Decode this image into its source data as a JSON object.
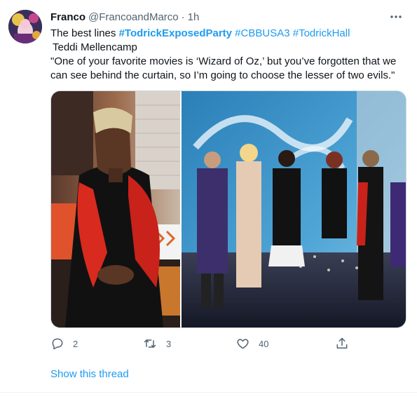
{
  "tweet": {
    "author_name": "Franco",
    "handle": "@FrancoandMarco",
    "separator": "·",
    "time": "1h",
    "text": {
      "intro": "The best lines ",
      "tag1": "#TodrickExposedParty",
      "tag2": " #CBBUSA3",
      "tag3": " #TodrickHall",
      "line2": "Teddi Mellencamp",
      "line3": "\"One of your favorite movies is ‘Wizard of Oz,’ but you’ve forgotten that we",
      "line4": "can see behind the curtain, so I’m going to choose the lesser of two evils.\""
    },
    "counts": {
      "replies": "2",
      "retweets": "3",
      "likes": "40"
    },
    "show_thread_label": "Show this thread"
  },
  "icons": {
    "more": "more-dots-icon",
    "reply": "reply-icon",
    "retweet": "retweet-icon",
    "like": "heart-icon",
    "share": "share-icon"
  },
  "colors": {
    "link": "#1d9bf0",
    "muted": "#536471",
    "text": "#0f1419"
  }
}
